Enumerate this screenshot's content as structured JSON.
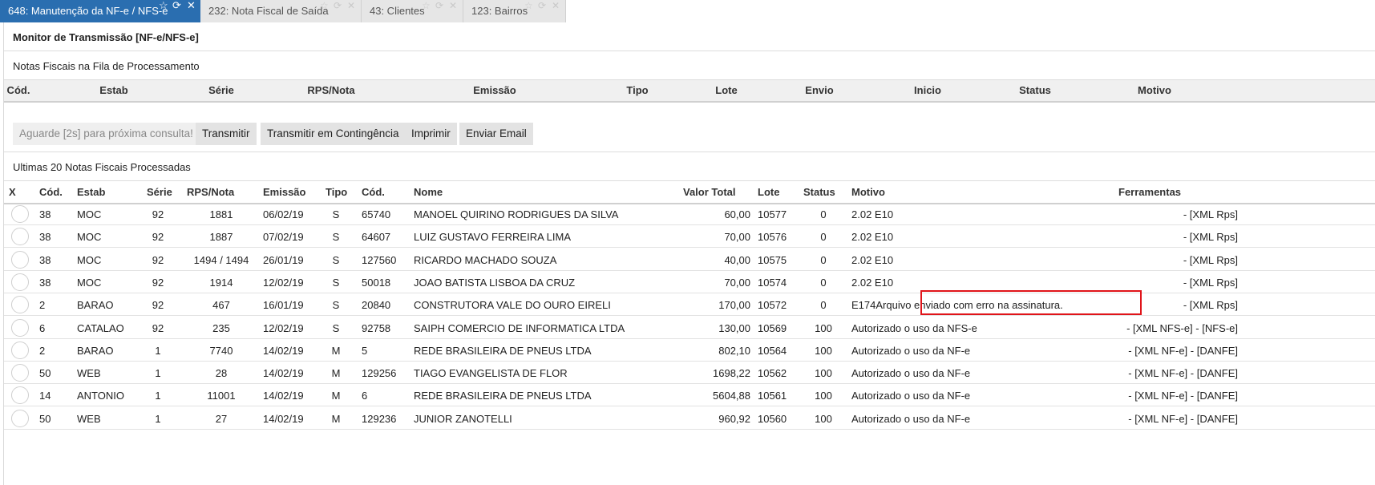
{
  "tabs": [
    {
      "label": "648: Manutenção da NF-e / NFS-e",
      "active": true
    },
    {
      "label": "232: Nota Fiscal de Saída",
      "active": false
    },
    {
      "label": "43: Clientes",
      "active": false
    },
    {
      "label": "123: Bairros",
      "active": false
    }
  ],
  "icons": {
    "star": "☆",
    "refresh": "⟳",
    "close": "✕"
  },
  "panel_title": "Monitor de Transmissão [NF-e/NFS-e]",
  "queue": {
    "title": "Notas Fiscais na Fila de Processamento",
    "columns": [
      "Cód.",
      "Estab",
      "Série",
      "RPS/Nota",
      "Emissão",
      "Tipo",
      "Lote",
      "Envio",
      "Inicio",
      "Status",
      "Motivo"
    ]
  },
  "buttons": {
    "wait": "Aguarde [2s] para próxima consulta!",
    "transmit": "Transmitir",
    "contingency": "Transmitir em Contingência",
    "print": "Imprimir",
    "email": "Enviar Email"
  },
  "processed": {
    "title": "Ultimas 20 Notas Fiscais Processadas",
    "columns": [
      "X",
      "Cód.",
      "Estab",
      "Série",
      "RPS/Nota",
      "Emissão",
      "Tipo",
      "Cód.",
      "Nome",
      "Valor Total",
      "Lote",
      "Status",
      "Motivo",
      "Ferramentas"
    ],
    "rows": [
      {
        "cod": "38",
        "estab": "MOC",
        "serie": "92",
        "rps": "1881",
        "emissao": "06/02/19",
        "tipo": "S",
        "cod_cli": "65740",
        "nome": "MANOEL QUIRINO RODRIGUES DA SILVA",
        "valor": "60,00",
        "lote": "10577",
        "status": "0",
        "motivo": "2.02 E10",
        "ferramentas": "- [XML Rps]"
      },
      {
        "cod": "38",
        "estab": "MOC",
        "serie": "92",
        "rps": "1887",
        "emissao": "07/02/19",
        "tipo": "S",
        "cod_cli": "64607",
        "nome": "LUIZ GUSTAVO FERREIRA LIMA",
        "valor": "70,00",
        "lote": "10576",
        "status": "0",
        "motivo": "2.02 E10",
        "ferramentas": "- [XML Rps]"
      },
      {
        "cod": "38",
        "estab": "MOC",
        "serie": "92",
        "rps": "1494 / 1494",
        "emissao": "26/01/19",
        "tipo": "S",
        "cod_cli": "127560",
        "nome": "RICARDO MACHADO SOUZA",
        "valor": "40,00",
        "lote": "10575",
        "status": "0",
        "motivo": "2.02 E10",
        "ferramentas": "- [XML Rps]"
      },
      {
        "cod": "38",
        "estab": "MOC",
        "serie": "92",
        "rps": "1914",
        "emissao": "12/02/19",
        "tipo": "S",
        "cod_cli": "50018",
        "nome": "JOAO BATISTA LISBOA DA CRUZ",
        "valor": "70,00",
        "lote": "10574",
        "status": "0",
        "motivo": "2.02 E10",
        "ferramentas": "- [XML Rps]"
      },
      {
        "cod": "2",
        "estab": "BARAO",
        "serie": "92",
        "rps": "467",
        "emissao": "16/01/19",
        "tipo": "S",
        "cod_cli": "20840",
        "nome": "CONSTRUTORA VALE DO OURO EIRELI",
        "valor": "170,00",
        "lote": "10572",
        "status": "0",
        "motivo": "E174Arquivo enviado com erro na assinatura.",
        "ferramentas": "- [XML Rps]",
        "highlight": true
      },
      {
        "cod": "6",
        "estab": "CATALAO",
        "serie": "92",
        "rps": "235",
        "emissao": "12/02/19",
        "tipo": "S",
        "cod_cli": "92758",
        "nome": "SAIPH COMERCIO DE INFORMATICA LTDA",
        "valor": "130,00",
        "lote": "10569",
        "status": "100",
        "motivo": "Autorizado o uso da NFS-e",
        "ferramentas": "- [XML NFS-e] - [NFS-e]"
      },
      {
        "cod": "2",
        "estab": "BARAO",
        "serie": "1",
        "rps": "7740",
        "emissao": "14/02/19",
        "tipo": "M",
        "cod_cli": "5",
        "nome": "REDE BRASILEIRA DE PNEUS LTDA",
        "valor": "802,10",
        "lote": "10564",
        "status": "100",
        "motivo": "Autorizado o uso da NF-e",
        "ferramentas": "- [XML NF-e] - [DANFE]"
      },
      {
        "cod": "50",
        "estab": "WEB",
        "serie": "1",
        "rps": "28",
        "emissao": "14/02/19",
        "tipo": "M",
        "cod_cli": "129256",
        "nome": "TIAGO EVANGELISTA DE FLOR",
        "valor": "1698,22",
        "lote": "10562",
        "status": "100",
        "motivo": "Autorizado o uso da NF-e",
        "ferramentas": "- [XML NF-e] - [DANFE]"
      },
      {
        "cod": "14",
        "estab": "ANTONIO",
        "serie": "1",
        "rps": "11001",
        "emissao": "14/02/19",
        "tipo": "M",
        "cod_cli": "6",
        "nome": "REDE BRASILEIRA DE PNEUS LTDA",
        "valor": "5604,88",
        "lote": "10561",
        "status": "100",
        "motivo": "Autorizado o uso da NF-e",
        "ferramentas": "- [XML NF-e] - [DANFE]"
      },
      {
        "cod": "50",
        "estab": "WEB",
        "serie": "1",
        "rps": "27",
        "emissao": "14/02/19",
        "tipo": "M",
        "cod_cli": "129236",
        "nome": "JUNIOR ZANOTELLI",
        "valor": "960,92",
        "lote": "10560",
        "status": "100",
        "motivo": "Autorizado o uso da NF-e",
        "ferramentas": "- [XML NF-e] - [DANFE]"
      }
    ]
  },
  "colors": {
    "active_tab": "#2a6eb0",
    "link": "#1f4e9c",
    "error_highlight": "#e0141a"
  }
}
